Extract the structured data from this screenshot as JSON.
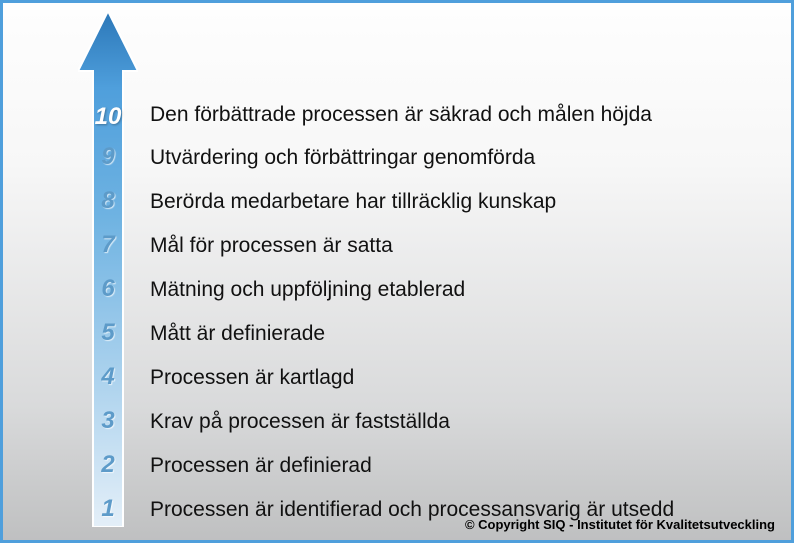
{
  "levels": [
    {
      "n": "10",
      "label": "Den förbättrade processen är säkrad och målen höjda"
    },
    {
      "n": "9",
      "label": "Utvärdering och förbättringar genomförda"
    },
    {
      "n": "8",
      "label": "Berörda medarbetare har tillräcklig kunskap"
    },
    {
      "n": "7",
      "label": "Mål för processen är satta"
    },
    {
      "n": "6",
      "label": "Mätning och uppföljning etablerad"
    },
    {
      "n": "5",
      "label": "Mått är definierade"
    },
    {
      "n": "4",
      "label": "Processen är kartlagd"
    },
    {
      "n": "3",
      "label": "Krav på processen är fastställda"
    },
    {
      "n": "2",
      "label": "Processen är definierad"
    },
    {
      "n": "1",
      "label": "Processen är identifierad och processansvarig är utsedd"
    }
  ],
  "copyright": "© Copyright   SIQ - Institutet för Kvalitetsutveckling"
}
